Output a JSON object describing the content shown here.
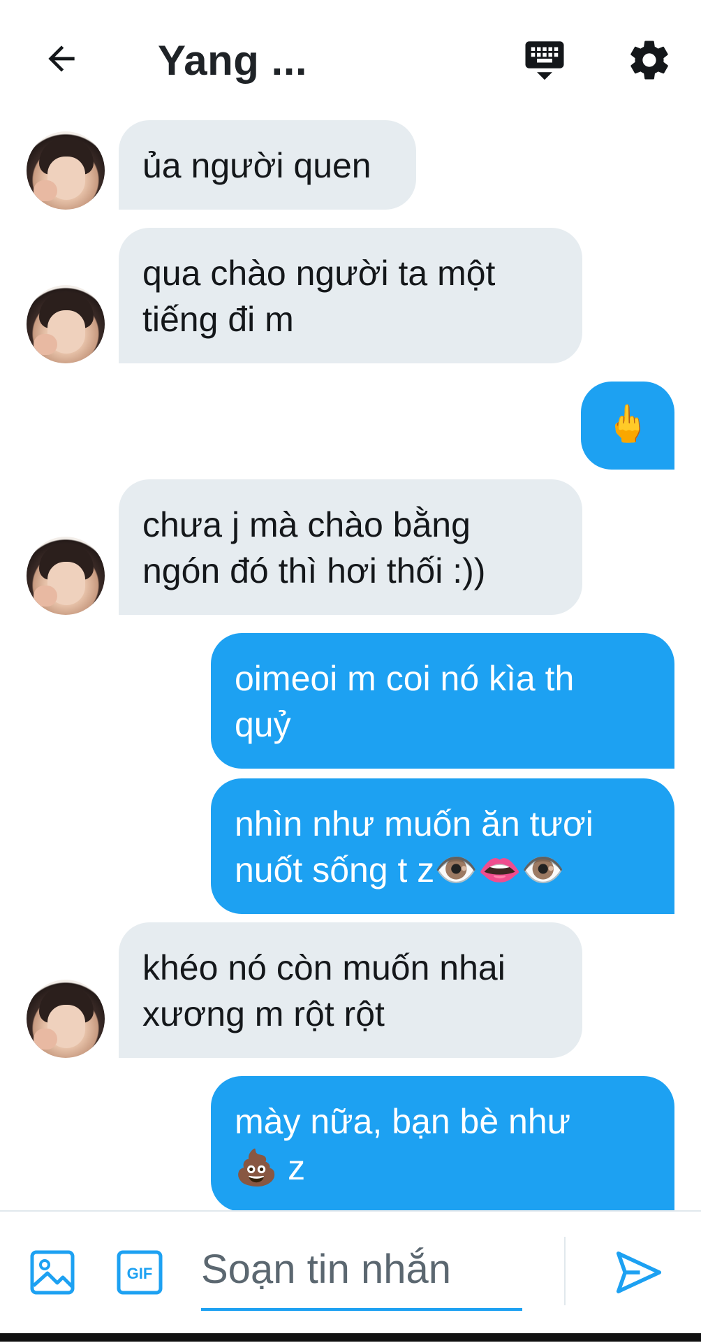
{
  "header": {
    "title": "Yang ...",
    "back_icon": "arrow-left-icon",
    "keyboard_icon": "keyboard-icon",
    "settings_icon": "gear-icon"
  },
  "messages": [
    {
      "direction": "in",
      "text": "ủa người quen"
    },
    {
      "direction": "in",
      "text": "qua chào người ta một\ntiếng đi m"
    },
    {
      "direction": "out",
      "text": "🖕"
    },
    {
      "direction": "in",
      "text": "chưa j mà chào bằng\nngón đó thì hơi thối :))"
    },
    {
      "direction": "out",
      "text": "oimeoi m coi nó kìa th\nquỷ"
    },
    {
      "direction": "out",
      "text": "nhìn như muốn ăn tươi\nnuốt sống t z👁️👄👁️"
    },
    {
      "direction": "in",
      "text": "khéo nó còn muốn nhai\nxương m rột rột"
    },
    {
      "direction": "out",
      "text": "mày nữa, bạn bè như\n💩 z"
    }
  ],
  "composer": {
    "placeholder": "Soạn tin nhắn",
    "image_icon": "image-icon",
    "gif_label": "GIF",
    "send_icon": "send-icon"
  },
  "colors": {
    "accent": "#1da1f2",
    "incoming_bubble": "#e6ecf0",
    "text": "#14171a"
  }
}
